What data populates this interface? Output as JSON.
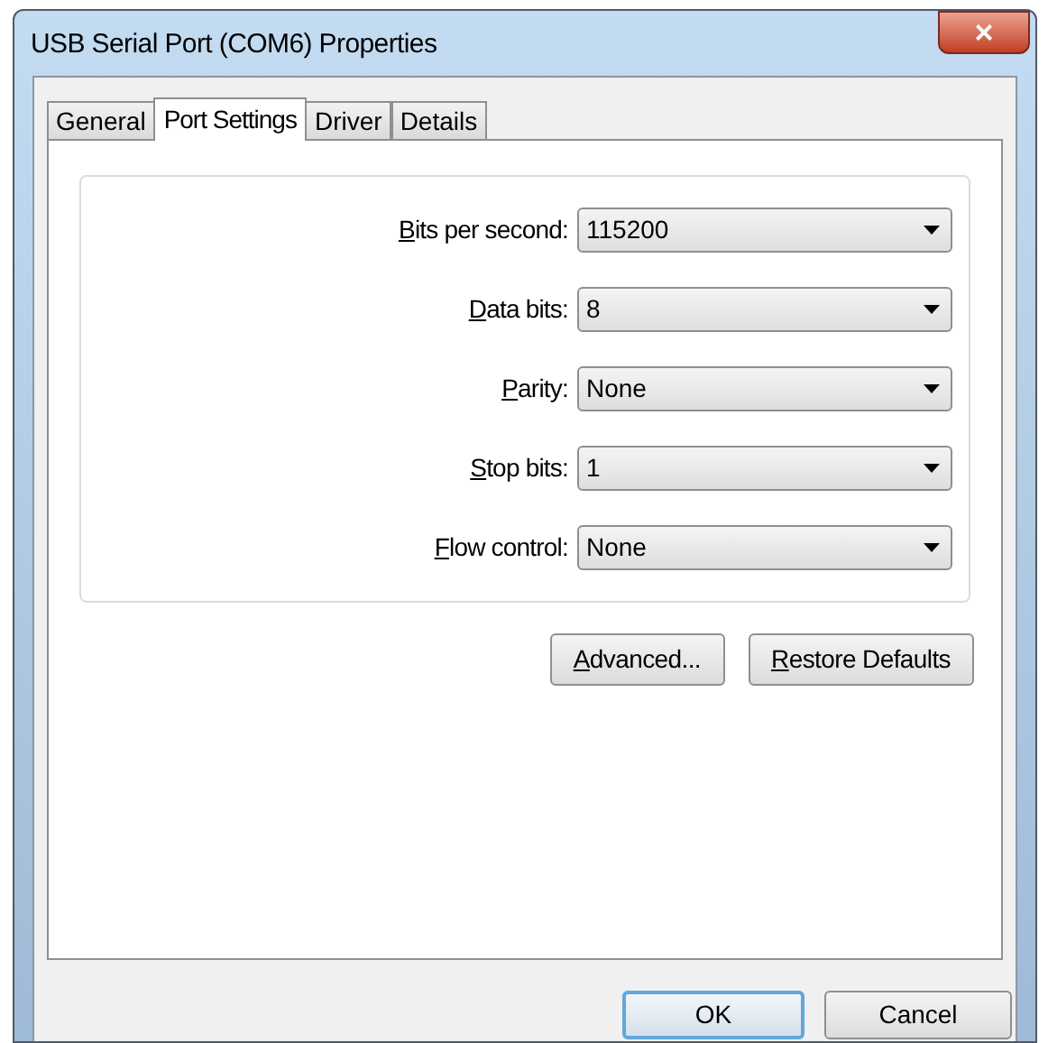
{
  "window": {
    "title": "USB Serial Port (COM6) Properties",
    "close": "×"
  },
  "tabs": [
    {
      "label": "General",
      "selected": false
    },
    {
      "label": "Port Settings",
      "selected": true
    },
    {
      "label": "Driver",
      "selected": false
    },
    {
      "label": "Details",
      "selected": false
    }
  ],
  "settings": [
    {
      "label": "Bits per second:",
      "value": "115200",
      "mnemonic": true
    },
    {
      "label": "Data bits:",
      "value": "8",
      "mnemonic": true
    },
    {
      "label": "Parity:",
      "value": "None",
      "mnemonic": true
    },
    {
      "label": "Stop bits:",
      "value": "1",
      "mnemonic": true
    },
    {
      "label": "Flow control:",
      "value": "None",
      "mnemonic": true
    }
  ],
  "panel_buttons": [
    {
      "label": "Advanced...",
      "mnemonic": true
    },
    {
      "label": "Restore Defaults",
      "mnemonic": true
    }
  ],
  "dialog_buttons": [
    {
      "label": "OK",
      "default": true
    },
    {
      "label": "Cancel",
      "default": false
    }
  ]
}
